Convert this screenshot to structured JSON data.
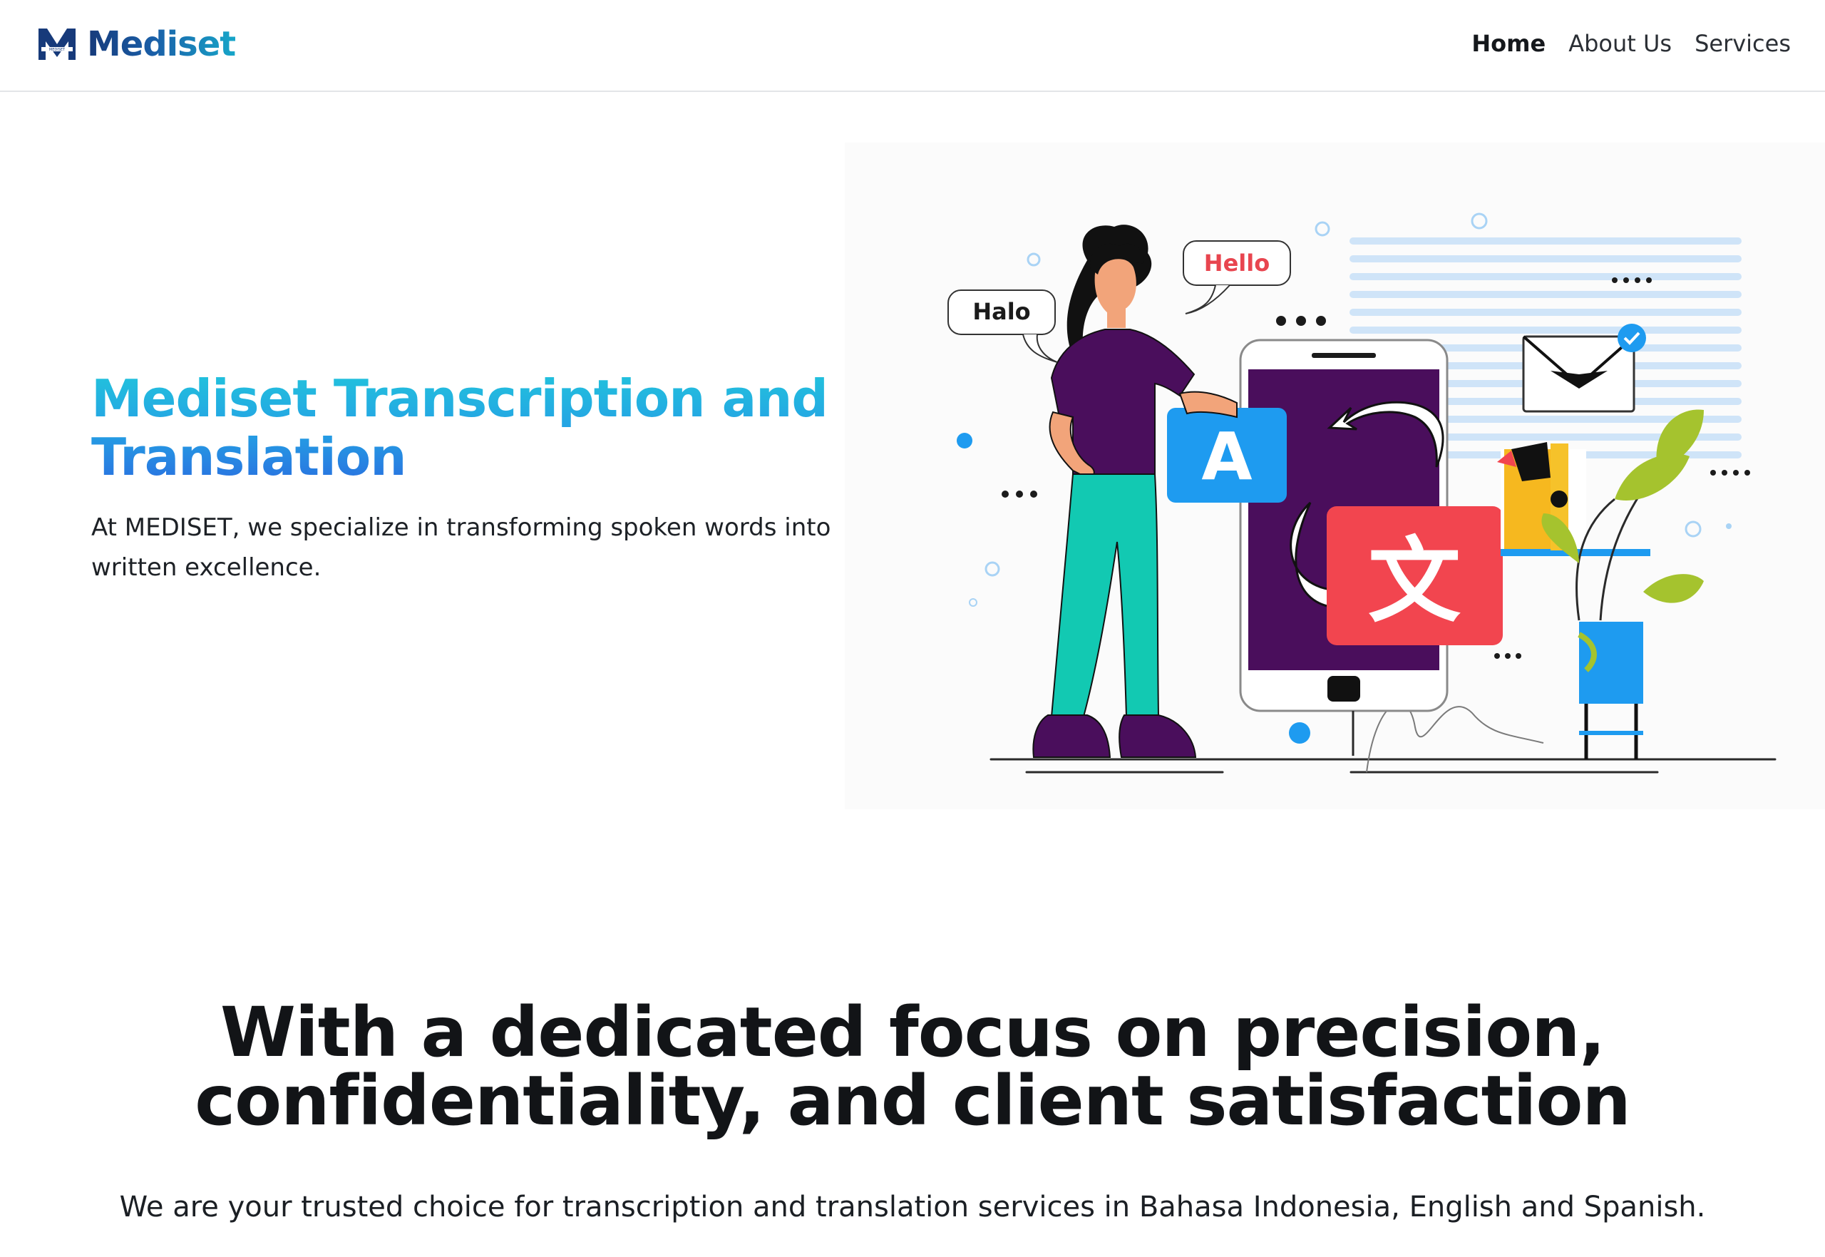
{
  "brand": {
    "name": "Mediset",
    "logo_text": "MEDISET"
  },
  "nav": {
    "items": [
      {
        "label": "Home",
        "active": true
      },
      {
        "label": "About Us",
        "active": false
      },
      {
        "label": "Services",
        "active": false
      }
    ]
  },
  "hero": {
    "title": "Mediset Transcription and Translation",
    "description": "At MEDISET, we specialize in transforming spoken words into written excellence."
  },
  "illustration": {
    "bubble_left": "Halo",
    "bubble_right": "Hello",
    "card_latin": "A",
    "card_cjk": "文"
  },
  "section": {
    "headline": "With a dedicated focus on precision, confidentiality, and client satisfaction",
    "subline": "We are your trusted choice for transcription and translation services in Bahasa Indonesia, English and Spanish."
  },
  "colors": {
    "brand_dark": "#173a7a",
    "brand_cyan": "#17a6c9",
    "hero_gradient_top": "#22c4dc",
    "hero_gradient_bottom": "#2a6fe0",
    "purple": "#4a0e5c",
    "teal": "#12c9b2",
    "blue_card": "#1e9bf0",
    "red_card": "#f2454f"
  }
}
